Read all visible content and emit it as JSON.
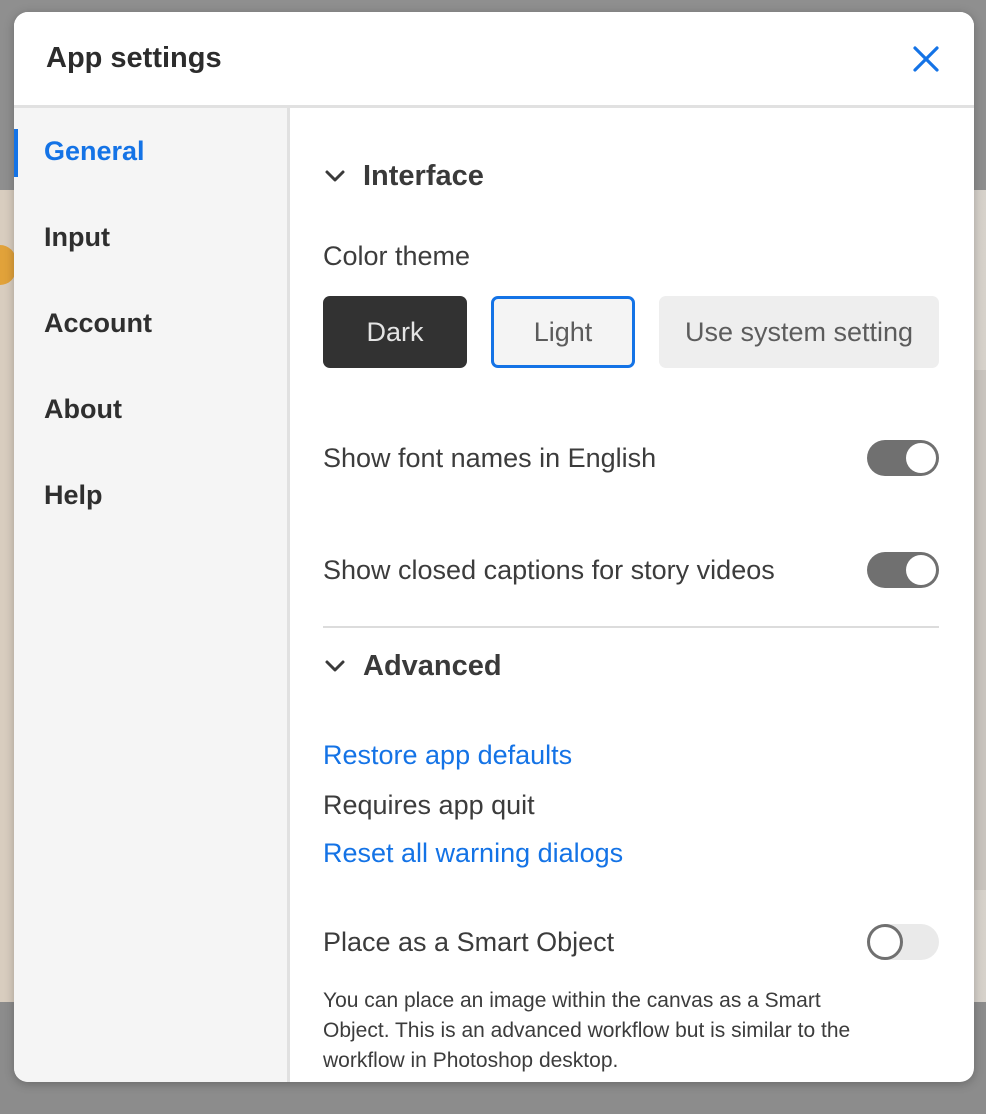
{
  "dialog": {
    "title": "App settings"
  },
  "sidebar": {
    "items": [
      {
        "label": "General"
      },
      {
        "label": "Input"
      },
      {
        "label": "Account"
      },
      {
        "label": "About"
      },
      {
        "label": "Help"
      }
    ],
    "active": "General"
  },
  "interface": {
    "heading": "Interface",
    "color_theme_label": "Color theme",
    "themes": [
      {
        "label": "Dark"
      },
      {
        "label": "Light"
      },
      {
        "label": "Use system setting"
      }
    ],
    "selected_theme": "Light",
    "toggles": [
      {
        "label": "Show font names in English",
        "on": true
      },
      {
        "label": "Show closed captions for story videos",
        "on": true
      }
    ]
  },
  "advanced": {
    "heading": "Advanced",
    "restore_link": "Restore app defaults",
    "restore_note": "Requires app quit",
    "reset_link": "Reset all warning dialogs",
    "smart_object": {
      "label": "Place as a Smart Object",
      "on": false,
      "description": "You can place an image within the canvas as a Smart Object. This is an advanced workflow but is similar to the workflow in Photoshop desktop."
    }
  },
  "colors": {
    "accent": "#1473e6",
    "toggle_on": "#707070",
    "dark_button": "#323232"
  },
  "icons": {
    "close": "close-icon",
    "section_chevron": "chevron-down-icon"
  }
}
